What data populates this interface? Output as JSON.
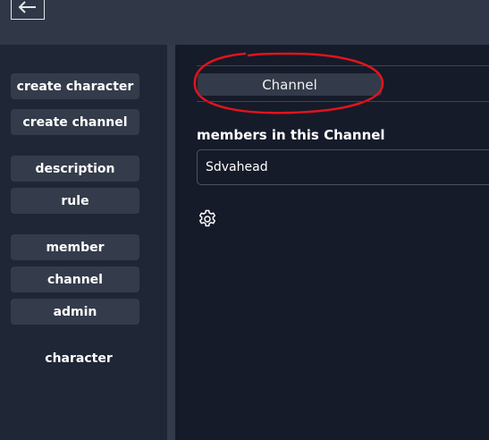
{
  "header": {
    "back_icon": "arrow-left-icon"
  },
  "sidebar": {
    "buttons": [
      {
        "label": "create character"
      },
      {
        "label": "create channel"
      },
      {
        "label": "description"
      },
      {
        "label": "rule"
      },
      {
        "label": "member"
      },
      {
        "label": "channel"
      },
      {
        "label": "admin"
      }
    ],
    "footer_label": "character"
  },
  "main": {
    "tab_label": "Channel",
    "members_title": "members in this Channel",
    "members": [
      {
        "name": "Sdvahead"
      }
    ],
    "settings_icon": "gear-icon",
    "highlight_color": "#e0141e"
  },
  "colors": {
    "background": "#151b29",
    "topbar": "#303847",
    "sidebar": "#1f2636",
    "button": "#343b4a"
  }
}
